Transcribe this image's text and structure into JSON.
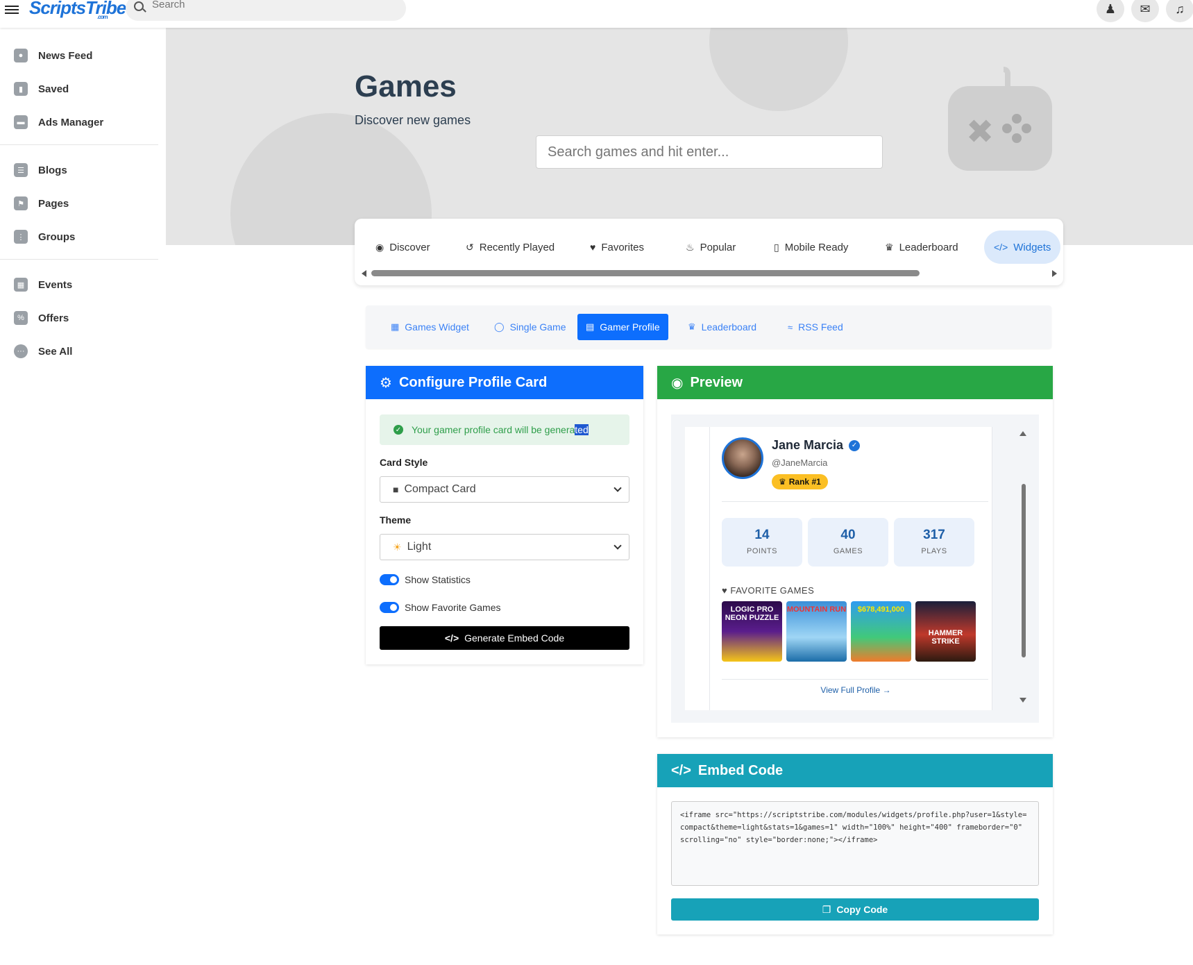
{
  "topbar": {
    "logo": "ScriptsTribe",
    "logo_suffix": ".com",
    "search_placeholder": "Search"
  },
  "sidebar": {
    "items": [
      {
        "label": "News Feed"
      },
      {
        "label": "Saved"
      },
      {
        "label": "Ads Manager"
      },
      {
        "label": "Blogs"
      },
      {
        "label": "Pages"
      },
      {
        "label": "Groups"
      },
      {
        "label": "Events"
      },
      {
        "label": "Offers"
      },
      {
        "label": "See All"
      }
    ]
  },
  "hero": {
    "title": "Games",
    "subtitle": "Discover new games",
    "search_placeholder": "Search games and hit enter..."
  },
  "tabs": [
    {
      "label": "Discover"
    },
    {
      "label": "Recently Played"
    },
    {
      "label": "Favorites"
    },
    {
      "label": "Popular"
    },
    {
      "label": "Mobile Ready"
    },
    {
      "label": "Leaderboard"
    },
    {
      "label": "Widgets"
    }
  ],
  "subtabs": [
    {
      "label": "Games Widget"
    },
    {
      "label": "Single Game"
    },
    {
      "label": "Gamer Profile"
    },
    {
      "label": "Leaderboard"
    },
    {
      "label": "RSS Feed"
    }
  ],
  "config": {
    "title": "Configure Profile Card",
    "alert_text": "Your gamer profile card will be genera",
    "alert_selected": "ted",
    "card_style_label": "Card Style",
    "card_style_value": "Compact Card",
    "theme_label": "Theme",
    "theme_value": "Light",
    "toggle_stats": "Show Statistics",
    "toggle_favs": "Show Favorite Games",
    "generate_label": "Generate Embed Code"
  },
  "preview": {
    "title": "Preview",
    "name": "Jane Marcia",
    "handle": "@JaneMarcia",
    "rank": "Rank #1",
    "stats": [
      {
        "value": "14",
        "label": "POINTS"
      },
      {
        "value": "40",
        "label": "GAMES"
      },
      {
        "value": "317",
        "label": "PLAYS"
      }
    ],
    "favorites_title": "FAVORITE GAMES",
    "games": [
      {
        "title": "LOGIC PRO NEON PUZZLE"
      },
      {
        "title": "MOUNTAIN RUN"
      },
      {
        "title": "$678,491,000"
      },
      {
        "title": "HAMMER STRIKE"
      }
    ],
    "view_link": "View Full Profile →"
  },
  "embed": {
    "title": "Embed Code",
    "code": "<iframe src=\"https://scriptstribe.com/modules/widgets/profile.php?user=1&style=compact&theme=light&stats=1&games=1\" width=\"100%\" height=\"400\" frameborder=\"0\" scrolling=\"no\" style=\"border:none;\"></iframe>",
    "copy_label": "Copy Code"
  },
  "colors": {
    "primary": "#0d6efd",
    "success": "#28a745",
    "info": "#17a2b8",
    "rank_badge": "#fbbf24"
  }
}
